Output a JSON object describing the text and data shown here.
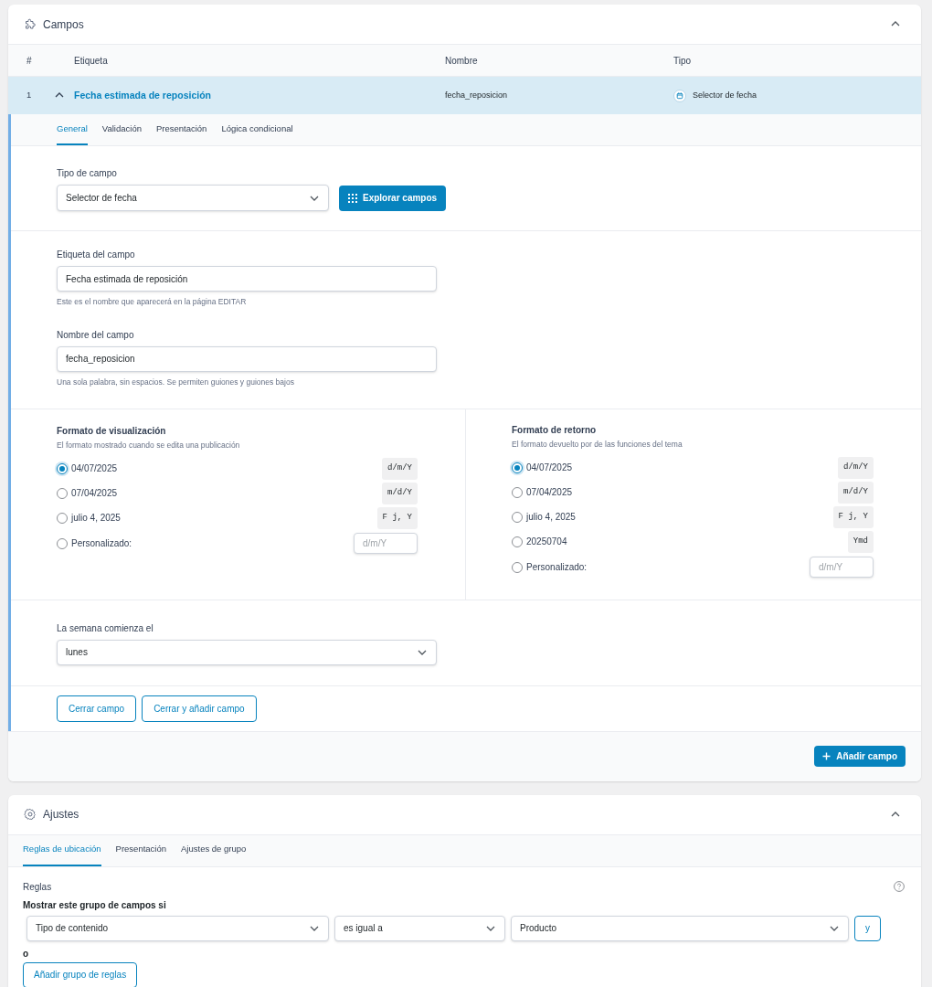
{
  "fields_panel": {
    "title": "Campos",
    "expanded": true
  },
  "table": {
    "columns": [
      "#",
      "Etiqueta",
      "Nombre",
      "Tipo"
    ],
    "rows": [
      {
        "number": "1",
        "label": "Fecha estimada de reposición",
        "name": "fecha_reposicion",
        "type": "Selector de fecha",
        "expanded": true
      }
    ]
  },
  "field_tabs": [
    {
      "label": "General",
      "selected": true
    },
    {
      "label": "Validación",
      "selected": false
    },
    {
      "label": "Presentación",
      "selected": false
    },
    {
      "label": "Lógica condicional",
      "selected": false
    }
  ],
  "field_type": {
    "label": "Tipo de campo",
    "value": "Selector de fecha",
    "browse_button": "Explorar campos"
  },
  "field_label": {
    "label": "Etiqueta del campo",
    "value": "Fecha estimada de reposición",
    "hint": "Este es el nombre que aparecerá en la página EDITAR"
  },
  "field_name": {
    "label": "Nombre del campo",
    "value": "fecha_reposicion",
    "hint": "Una sola palabra, sin espacios. Se permiten guiones y guiones bajos"
  },
  "display_format": {
    "title": "Formato de visualización",
    "description": "El formato mostrado cuando se edita una publicación",
    "options": [
      {
        "kind": "preset",
        "label": "04/07/2025",
        "code": "d/m/Y",
        "selected": true
      },
      {
        "kind": "preset",
        "label": "07/04/2025",
        "code": "m/d/Y",
        "selected": false
      },
      {
        "kind": "preset",
        "label": "julio 4, 2025",
        "code": "F j, Y",
        "selected": false
      },
      {
        "kind": "custom",
        "label": "Personalizado:",
        "placeholder": "d/m/Y",
        "selected": false
      }
    ]
  },
  "return_format": {
    "title": "Formato de retorno",
    "description": "El formato devuelto por de las funciones del tema",
    "options": [
      {
        "kind": "preset",
        "label": "04/07/2025",
        "code": "d/m/Y",
        "selected": true
      },
      {
        "kind": "preset",
        "label": "07/04/2025",
        "code": "m/d/Y",
        "selected": false
      },
      {
        "kind": "preset",
        "label": "julio 4, 2025",
        "code": "F j, Y",
        "selected": false
      },
      {
        "kind": "preset",
        "label": "20250704",
        "code": "Ymd",
        "selected": false
      },
      {
        "kind": "custom",
        "label": "Personalizado:",
        "placeholder": "d/m/Y",
        "selected": false
      }
    ]
  },
  "week_start": {
    "label": "La semana comienza el",
    "value": "lunes"
  },
  "field_actions": [
    "Cerrar campo",
    "Cerrar y añadir campo"
  ],
  "add_field_button": "Añadir campo",
  "settings_panel": {
    "title": "Ajustes",
    "expanded": true
  },
  "settings_tabs": [
    {
      "label": "Reglas de ubicación",
      "selected": true
    },
    {
      "label": "Presentación",
      "selected": false
    },
    {
      "label": "Ajustes de grupo",
      "selected": false
    }
  ],
  "rules": {
    "title": "Reglas",
    "subtitle": "Mostrar este grupo de campos si",
    "conditions": [
      {
        "param": "Tipo de contenido",
        "operator": "es igual a",
        "value": "Producto",
        "and_button": "y"
      }
    ],
    "or_label": "o",
    "add_group_button": "Añadir grupo de reglas"
  }
}
